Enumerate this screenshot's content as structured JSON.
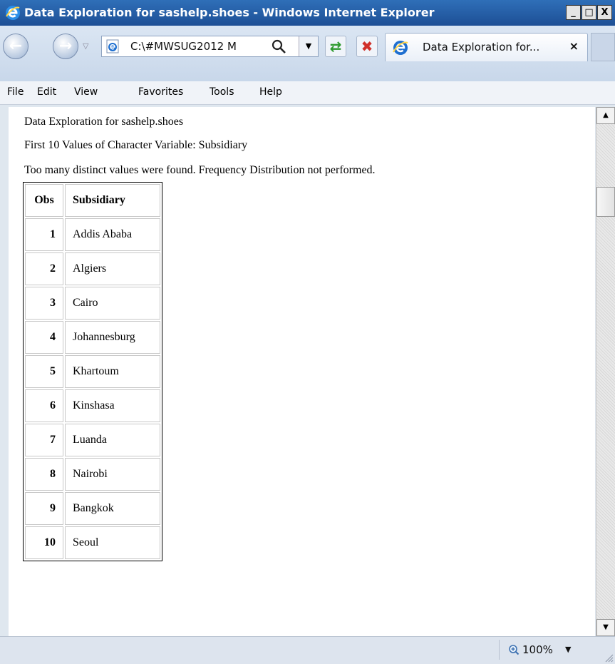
{
  "window": {
    "title": "Data Exploration for sashelp.shoes - Windows Internet Explorer",
    "minimize": "_",
    "maximize": "□",
    "close": "X"
  },
  "toolbar": {
    "address_url": "C:\\#MWSUG2012 M",
    "tab_title": "Data Exploration for...",
    "tab_close": "×"
  },
  "menu": [
    "File",
    "Edit",
    "View",
    "Favorites",
    "Tools",
    "Help"
  ],
  "content": {
    "line1": "Data Exploration for sashelp.shoes",
    "line2": "First 10 Values of Character Variable: Subsidiary",
    "line3": "Too many distinct values were found. Frequency Distribution not performed.",
    "table": {
      "headers": [
        "Obs",
        "Subsidiary"
      ],
      "rows": [
        [
          "1",
          "Addis Ababa"
        ],
        [
          "2",
          "Algiers"
        ],
        [
          "3",
          "Cairo"
        ],
        [
          "4",
          "Johannesburg"
        ],
        [
          "5",
          "Khartoum"
        ],
        [
          "6",
          "Kinshasa"
        ],
        [
          "7",
          "Luanda"
        ],
        [
          "8",
          "Nairobi"
        ],
        [
          "9",
          "Bangkok"
        ],
        [
          "10",
          "Seoul"
        ]
      ]
    }
  },
  "status": {
    "zoom": "100%"
  },
  "icons": {
    "ie_logo": "ie-logo-icon",
    "back": "back-icon",
    "forward": "forward-icon",
    "refresh": "refresh-icon",
    "stop": "stop-icon",
    "search": "search-icon",
    "zoom": "zoom-icon"
  },
  "colors": {
    "titlebar": "#1d4f95",
    "refresh_green": "#2e9a2e",
    "stop_red": "#d0302a",
    "ie_blue": "#1e6fd0"
  }
}
